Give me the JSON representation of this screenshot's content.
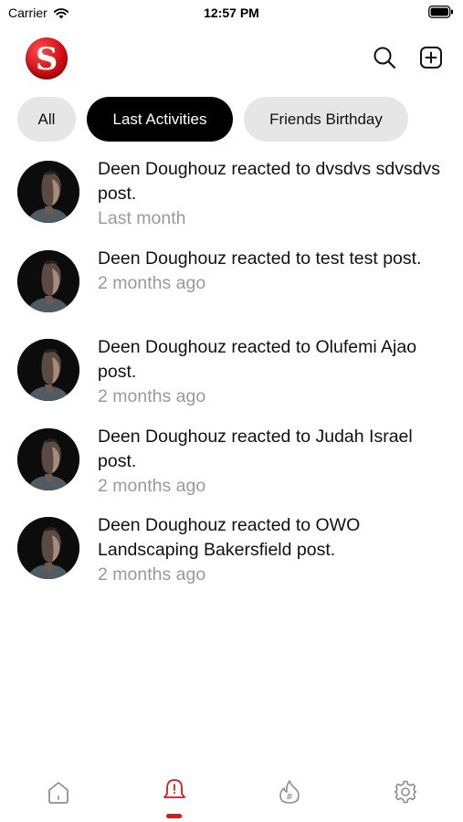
{
  "status_bar": {
    "carrier": "Carrier",
    "time": "12:57 PM"
  },
  "header": {
    "logo_letter": "S",
    "brand_color": "#d10f14"
  },
  "filters": [
    {
      "label": "All",
      "active": false
    },
    {
      "label": "Last Activities",
      "active": true
    },
    {
      "label": "Friends Birthday",
      "active": false
    }
  ],
  "notifications": [
    {
      "message": "Deen Doughouz reacted to dvsdvs sdvsdvs post.",
      "time": "Last month"
    },
    {
      "message": "Deen Doughouz reacted to test test post.",
      "time": "2 months ago"
    },
    {
      "message": "Deen Doughouz reacted to Olufemi Ajao post.",
      "time": "2 months ago"
    },
    {
      "message": "Deen Doughouz reacted to Judah Israel post.",
      "time": "2 months ago"
    },
    {
      "message": "Deen Doughouz reacted to OWO Landscaping Bakersfield post.",
      "time": "2 months ago"
    }
  ],
  "tabbar": {
    "items": [
      "home-icon",
      "bell-icon",
      "trending-hashtag-icon",
      "gear-icon"
    ],
    "active_index": 1,
    "active_color": "#e0161b",
    "inactive_color": "#8e8e8e"
  }
}
